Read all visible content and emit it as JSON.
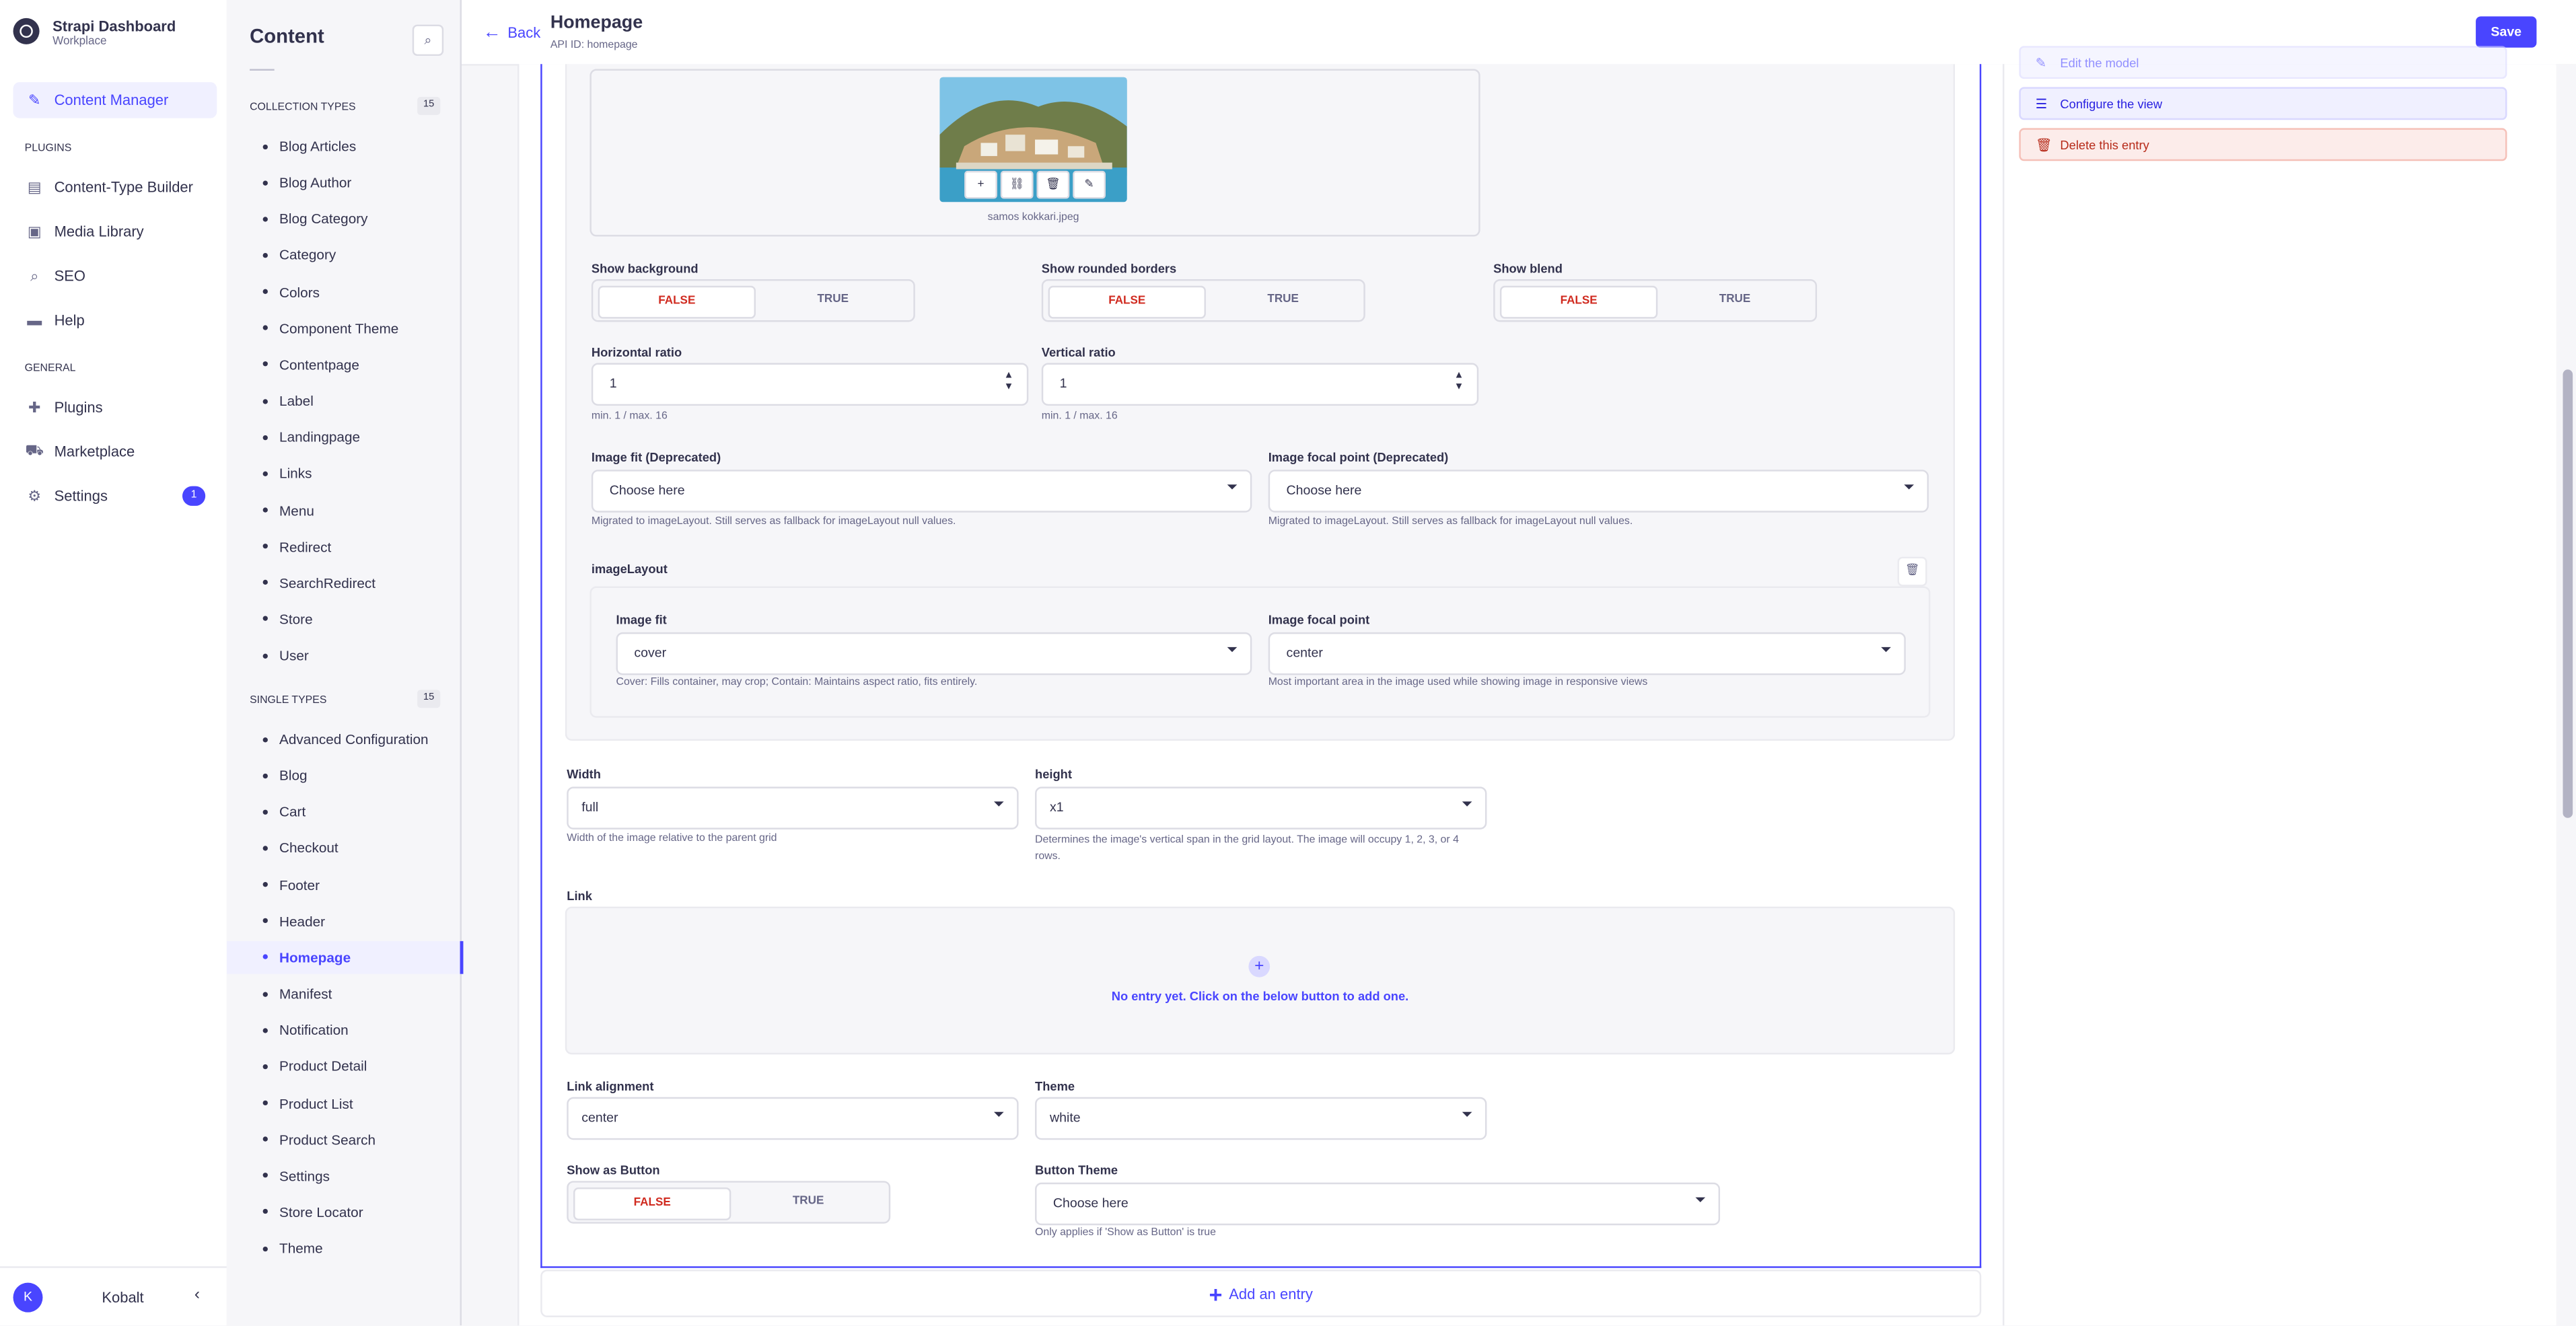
{
  "brand": {
    "title": "Strapi Dashboard",
    "subtitle": "Workplace"
  },
  "main_nav": {
    "content_manager": "Content Manager",
    "plugins_header": "PLUGINS",
    "plugins": [
      "Content-Type Builder",
      "Media Library",
      "SEO",
      "Help"
    ],
    "general_header": "GENERAL",
    "general": [
      "Plugins",
      "Marketplace",
      "Settings"
    ],
    "settings_badge": "1",
    "user_initial": "K",
    "user_name": "Kobalt"
  },
  "sub_nav": {
    "title": "Content",
    "collection_header": "COLLECTION TYPES",
    "collection_count": "15",
    "collection_types": [
      "Blog Articles",
      "Blog Author",
      "Blog Category",
      "Category",
      "Colors",
      "Component Theme",
      "Contentpage",
      "Label",
      "Landingpage",
      "Links",
      "Menu",
      "Redirect",
      "SearchRedirect",
      "Store",
      "User"
    ],
    "single_header": "SINGLE TYPES",
    "single_count": "15",
    "single_types": [
      "Advanced Configuration",
      "Blog",
      "Cart",
      "Checkout",
      "Footer",
      "Header",
      "Homepage",
      "Manifest",
      "Notification",
      "Product Detail",
      "Product List",
      "Product Search",
      "Settings",
      "Store Locator",
      "Theme"
    ]
  },
  "header": {
    "back": "Back",
    "title": "Homepage",
    "api_id": "API ID: homepage",
    "save": "Save"
  },
  "media": {
    "filename": "samos kokkari.jpeg"
  },
  "fields": {
    "show_background": "Show background",
    "show_rounded_borders": "Show rounded borders",
    "show_blend": "Show blend",
    "false_label": "FALSE",
    "true_label": "TRUE",
    "horizontal_ratio": "Horizontal ratio",
    "horizontal_ratio_value": "1",
    "vertical_ratio": "Vertical ratio",
    "vertical_ratio_value": "1",
    "ratio_hint": "min. 1 / max. 16",
    "image_fit_deprecated": "Image fit (Deprecated)",
    "image_focal_deprecated": "Image focal point (Deprecated)",
    "choose_here": "Choose here",
    "deprecated_hint": "Migrated to imageLayout. Still serves as fallback for imageLayout null values.",
    "image_layout": "imageLayout",
    "image_fit": "Image fit",
    "image_fit_value": "cover",
    "image_fit_hint": "Cover: Fills container, may crop; Contain: Maintains aspect ratio, fits entirely.",
    "image_focal": "Image focal point",
    "image_focal_value": "center",
    "image_focal_hint": "Most important area in the image used while showing image in responsive views",
    "width": "Width",
    "width_value": "full",
    "width_hint": "Width of the image relative to the parent grid",
    "height": "height",
    "height_value": "x1",
    "height_hint": "Determines the image's vertical span in the grid layout. The image will occupy 1, 2, 3, or 4 rows.",
    "link": "Link",
    "link_empty": "No entry yet. Click on the below button to add one.",
    "link_alignment": "Link alignment",
    "link_alignment_value": "center",
    "theme": "Theme",
    "theme_value": "white",
    "show_as_button": "Show as Button",
    "button_theme": "Button Theme",
    "button_theme_hint": "Only applies if 'Show as Button' is true",
    "add_entry": "Add an entry"
  },
  "side_panel": {
    "edit_model": "Edit the model",
    "configure_view": "Configure the view",
    "delete_entry": "Delete this entry"
  },
  "colors": {
    "primary": "#4945ff",
    "danger": "#d02b20",
    "text": "#32324d",
    "muted": "#666687"
  }
}
